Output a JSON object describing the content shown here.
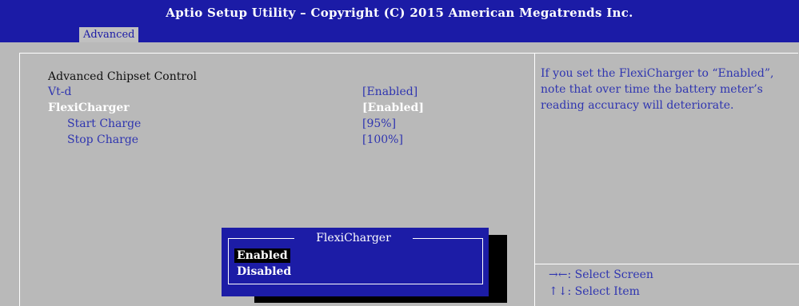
{
  "window": {
    "title": "Aptio Setup Utility – Copyright (C) 2015 American Megatrends Inc."
  },
  "tabs": [
    "Advanced"
  ],
  "main": {
    "section_title": "Advanced Chipset Control",
    "items": [
      {
        "label": "Vt-d",
        "value": "[Enabled]",
        "style": "blue"
      },
      {
        "label": "FlexiCharger",
        "value": "[Enabled]",
        "style": "highlight"
      },
      {
        "label": "Start Charge",
        "value": "[95%]",
        "style": "blue-sub"
      },
      {
        "label": "Stop Charge",
        "value": "[100%]",
        "style": "blue-sub"
      }
    ]
  },
  "help": {
    "text": "If you set the FlexiCharger to “Enabled”, note that over time the battery meter’s reading accuracy will deteriorate."
  },
  "keys": [
    {
      "key": "→←",
      "action": ": Select Screen"
    },
    {
      "key": "↑↓",
      "action": ": Select Item"
    }
  ],
  "popup": {
    "title": "FlexiCharger",
    "options": [
      "Enabled",
      "Disabled"
    ],
    "selected": "Enabled"
  },
  "colors": {
    "header_bg": "#1b1ba6",
    "panel_bg": "#b9b9b9",
    "text_blue": "#2f35b0",
    "text_white": "#ffffff",
    "popup_bg": "#1c1ca6",
    "selection_bg": "#000000"
  }
}
